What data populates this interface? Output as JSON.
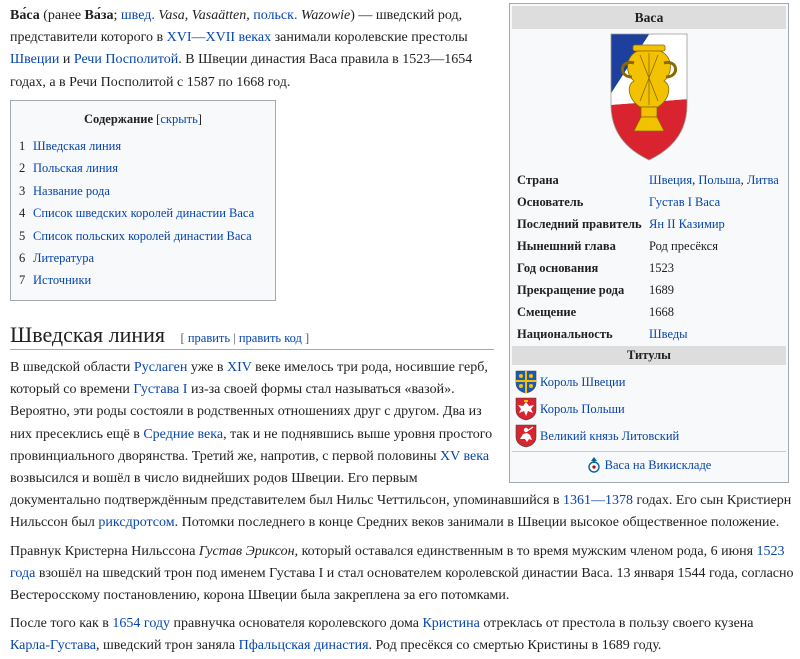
{
  "infobox": {
    "title": "Васа",
    "rows": [
      {
        "k": "Страна",
        "v": [
          {
            "t": "Швеция",
            "link": true
          },
          {
            "t": ", ",
            "link": false
          },
          {
            "t": "Польша",
            "link": true
          },
          {
            "t": ", ",
            "link": false
          },
          {
            "t": "Литва",
            "link": true
          }
        ]
      },
      {
        "k": "Основатель",
        "v": [
          {
            "t": "Густав I Васа",
            "link": true
          }
        ]
      },
      {
        "k": "Последний правитель",
        "v": [
          {
            "t": "Ян II Казимир",
            "link": true
          }
        ]
      },
      {
        "k": "Нынешний глава",
        "v": [
          {
            "t": "Род пресёкся",
            "link": false
          }
        ]
      },
      {
        "k": "Год основания",
        "v": [
          {
            "t": "1523",
            "link": false
          }
        ]
      },
      {
        "k": "Прекращение рода",
        "v": [
          {
            "t": "1689",
            "link": false
          }
        ]
      },
      {
        "k": "Смещение",
        "v": [
          {
            "t": "1668",
            "link": false
          }
        ]
      },
      {
        "k": "Национальность",
        "v": [
          {
            "t": "Шведы",
            "link": true
          }
        ]
      }
    ],
    "titles_header": "Титулы",
    "titles": [
      "Король Швеции",
      "Король Польши",
      "Великий князь Литовский"
    ],
    "commons": "Васа на Викискладе",
    "colors": {
      "blue": "#1d3f9e",
      "red": "#d9232e",
      "gold": "#f2c200"
    }
  },
  "lead": [
    {
      "t": "Ва́са",
      "b": true
    },
    {
      "t": " (ранее "
    },
    {
      "t": "Ва́за",
      "b": true
    },
    {
      "t": "; "
    },
    {
      "t": "швед.",
      "link": true
    },
    {
      "t": " "
    },
    {
      "t": "Vasa, Vasaätten",
      "i": true
    },
    {
      "t": ", "
    },
    {
      "t": "польск.",
      "link": true
    },
    {
      "t": " "
    },
    {
      "t": "Wazowie",
      "i": true
    },
    {
      "t": ") — шведский род, представители которого в "
    },
    {
      "t": "XVI",
      "link": true
    },
    {
      "t": "—",
      "link": true
    },
    {
      "t": "XVII веках",
      "link": true
    },
    {
      "t": " занимали королевские престолы "
    },
    {
      "t": "Швеции",
      "link": true
    },
    {
      "t": " и "
    },
    {
      "t": "Речи Посполитой",
      "link": true
    },
    {
      "t": ". В Швеции династия Васа правила в 1523—1654 годах, а в Речи Посполитой с 1587 по 1668 год."
    }
  ],
  "toc": {
    "title": "Содержание",
    "toggle": "скрыть",
    "items": [
      {
        "num": "1",
        "label": "Шведская линия"
      },
      {
        "num": "2",
        "label": "Польская линия"
      },
      {
        "num": "3",
        "label": "Название рода"
      },
      {
        "num": "4",
        "label": "Список шведских королей династии Васа"
      },
      {
        "num": "5",
        "label": "Список польских королей династии Васа"
      },
      {
        "num": "6",
        "label": "Литература"
      },
      {
        "num": "7",
        "label": "Источники"
      }
    ]
  },
  "section": {
    "heading": "Шведская линия",
    "edit": "править",
    "edit_code": "править код"
  },
  "para1": [
    {
      "t": "В шведской области "
    },
    {
      "t": "Руслаген",
      "link": true
    },
    {
      "t": " уже в "
    },
    {
      "t": "XIV",
      "link": true
    },
    {
      "t": " веке имелось три рода, носившие герб, который со времени "
    },
    {
      "t": "Густава I",
      "link": true
    },
    {
      "t": " из-за своей формы стал называться «вазой». Вероятно, эти роды состояли в родственных отношениях друг с другом. Два из них пресеклись ещё в "
    },
    {
      "t": "Средние века",
      "link": true
    },
    {
      "t": ", так и не поднявшись выше уровня простого провинциального дворянства. Третий же, напротив, с первой половины "
    },
    {
      "t": "XV века",
      "link": true
    },
    {
      "t": " возвысился и вошёл в число виднейших родов Швеции. Его первым"
    }
  ],
  "para1b": [
    {
      "t": "документально подтверждённым представителем был Нильс Четтильсон, упоминавшийся в "
    },
    {
      "t": "1361",
      "link": true
    },
    {
      "t": "—",
      "link": true
    },
    {
      "t": "1378",
      "link": true
    },
    {
      "t": " годах. Его сын Кристиерн Нильссон был "
    },
    {
      "t": "риксдротсом",
      "link": true
    },
    {
      "t": ". Потомки последнего в конце Средних веков занимали в Швеции высокое общественное положение."
    }
  ],
  "para2": [
    {
      "t": "Правнук Кристерна Нильссона "
    },
    {
      "t": "Густав Эриксон",
      "i": true
    },
    {
      "t": ", который оставался единственным в то время мужским членом рода, 6 июня "
    },
    {
      "t": "1523 года",
      "link": true
    },
    {
      "t": " взошёл на шведский трон под именем Густава I и стал основателем королевской династии Васа. 13 января 1544 года, согласно Вестеросскому постановлению, корона Швеции была закреплена за его потомками."
    }
  ],
  "para3": [
    {
      "t": "После того как в "
    },
    {
      "t": "1654 году",
      "link": true
    },
    {
      "t": " правнучка основателя королевского дома "
    },
    {
      "t": "Кристина",
      "link": true
    },
    {
      "t": " отреклась от престола в пользу своего кузена "
    },
    {
      "t": "Карла-Густава",
      "link": true
    },
    {
      "t": ", шведский трон заняла "
    },
    {
      "t": "Пфальцская династия",
      "link": true
    },
    {
      "t": ". Род пресёкся со смертью Кристины в 1689 году."
    }
  ]
}
